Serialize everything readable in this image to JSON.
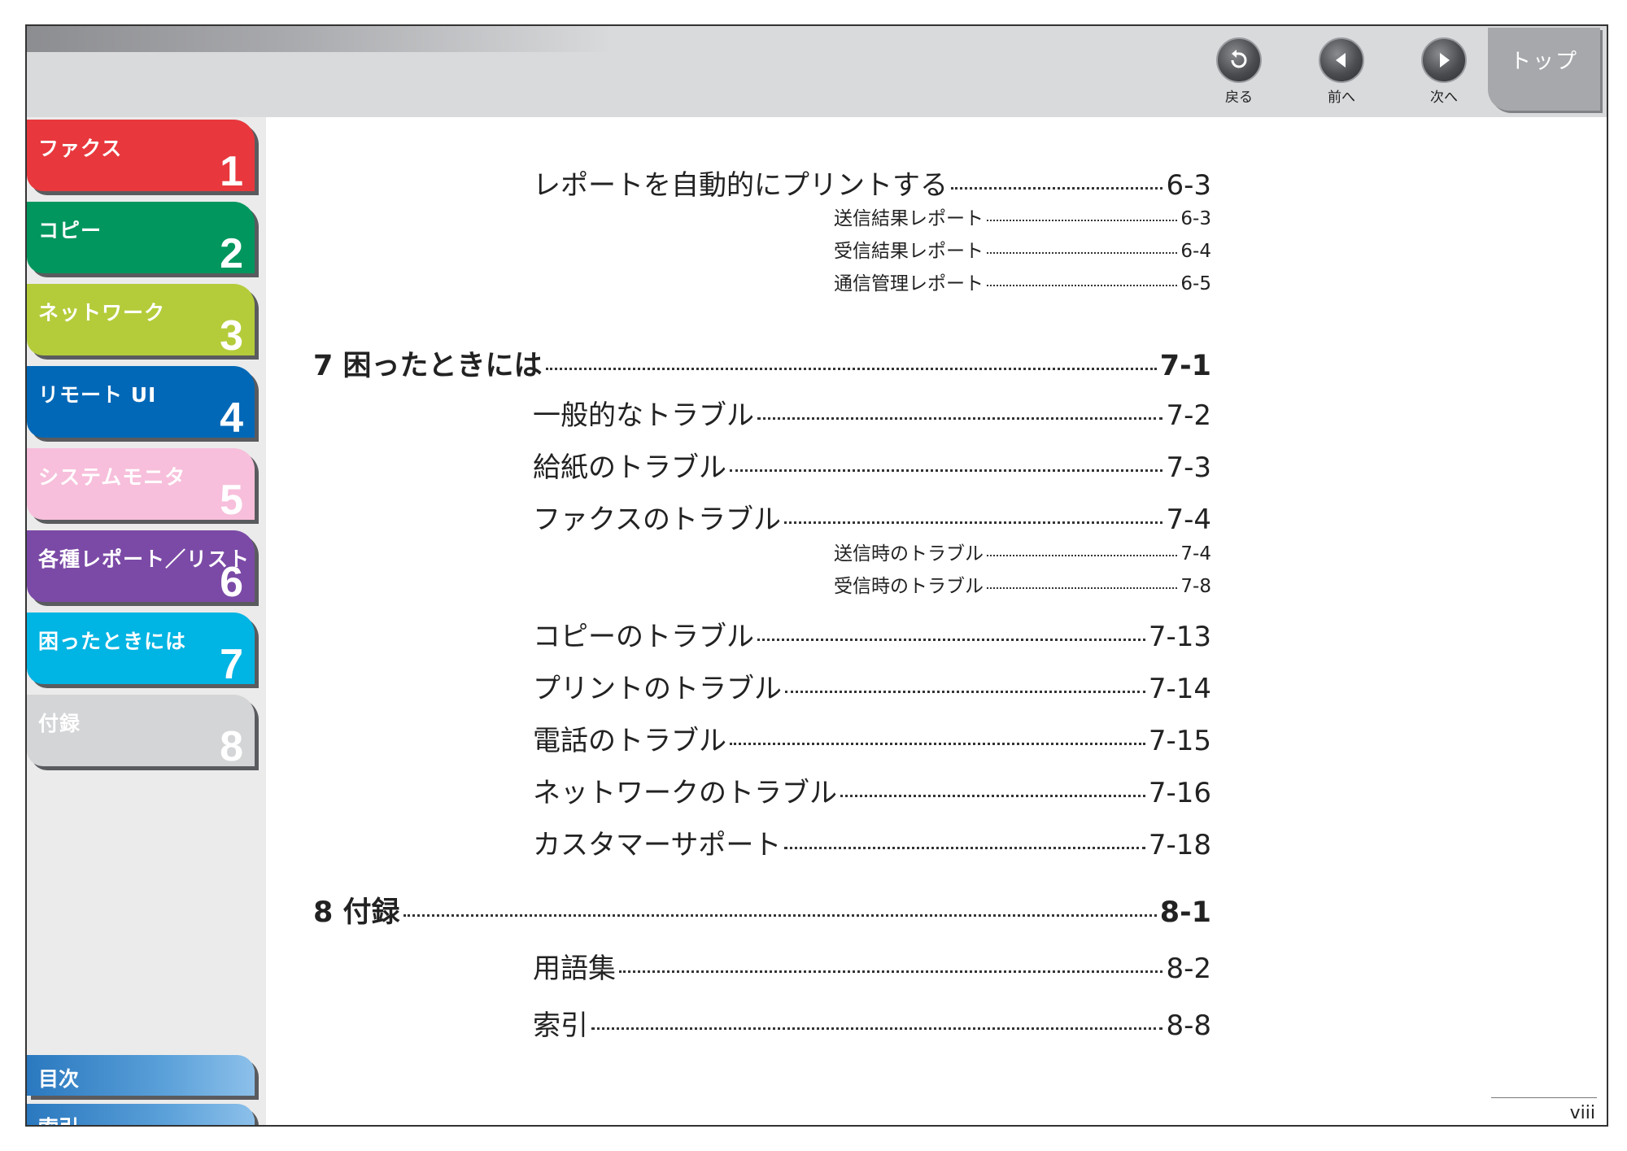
{
  "nav": {
    "back_label": "戻る",
    "prev_label": "前へ",
    "next_label": "次へ",
    "top_label": "トップ"
  },
  "sidebar": {
    "tabs": [
      {
        "label": "ファクス",
        "number": "1",
        "color": "#e8383d"
      },
      {
        "label": "コピー",
        "number": "2",
        "color": "#00965e"
      },
      {
        "label": "ネットワーク",
        "number": "3",
        "color": "#b4cc3a"
      },
      {
        "label": "リモート UI",
        "number": "4",
        "color": "#0068b7"
      },
      {
        "label": "システムモニタ",
        "number": "5",
        "color": "#f7bfdb"
      },
      {
        "label": "各種レポート／リスト",
        "number": "6",
        "color": "#7b4aa6"
      },
      {
        "label": "困ったときには",
        "number": "7",
        "color": "#00b4e3"
      },
      {
        "label": "付録",
        "number": "8",
        "color": "#d4d5d7"
      }
    ],
    "contents_label": "目次",
    "index_label": "索引"
  },
  "toc": [
    {
      "level": 2,
      "text": "レポートを自動的にプリントする",
      "page": "6-3"
    },
    {
      "level": 3,
      "text": "送信結果レポート",
      "page": "6-3"
    },
    {
      "level": 3,
      "text": "受信結果レポート",
      "page": "6-4"
    },
    {
      "level": 3,
      "text": "通信管理レポート",
      "page": "6-5"
    },
    {
      "level": 1,
      "text": "7 困ったときには",
      "page": "7-1"
    },
    {
      "level": 2,
      "text": "一般的なトラブル",
      "page": "7-2"
    },
    {
      "level": 2,
      "text": "給紙のトラブル",
      "page": "7-3"
    },
    {
      "level": 2,
      "text": "ファクスのトラブル",
      "page": "7-4"
    },
    {
      "level": 3,
      "text": "送信時のトラブル",
      "page": "7-4"
    },
    {
      "level": 3,
      "text": "受信時のトラブル",
      "page": "7-8"
    },
    {
      "level": 2,
      "text": "コピーのトラブル",
      "page": "7-13"
    },
    {
      "level": 2,
      "text": "プリントのトラブル",
      "page": "7-14"
    },
    {
      "level": 2,
      "text": "電話のトラブル",
      "page": "7-15"
    },
    {
      "level": 2,
      "text": "ネットワークのトラブル",
      "page": "7-16"
    },
    {
      "level": 2,
      "text": "カスタマーサポート",
      "page": "7-18"
    },
    {
      "level": 1,
      "text": "8 付録",
      "page": "8-1"
    },
    {
      "level": 2,
      "text": "用語集",
      "page": "8-2"
    },
    {
      "level": 2,
      "text": "索引",
      "page": "8-8"
    }
  ],
  "footer": {
    "page_number": "viii"
  }
}
